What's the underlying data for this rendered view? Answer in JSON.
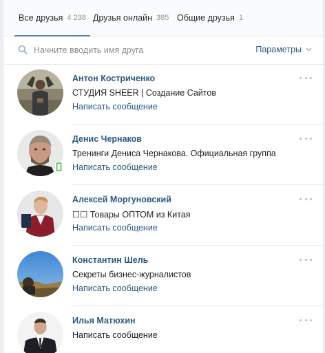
{
  "tabs": [
    {
      "label": "Все друзья",
      "count": "4 238"
    },
    {
      "label": "Друзья онлайн",
      "count": "385"
    },
    {
      "label": "Общие друзья",
      "count": "1"
    }
  ],
  "search": {
    "placeholder": "Начните вводить имя друга",
    "params_label": "Параметры"
  },
  "friends": [
    {
      "name": "Антон Костриченко",
      "subtitle": "СТУДИЯ SHEER | Создание Сайтов",
      "message_link": "Написать сообщение"
    },
    {
      "name": "Денис Чернаков",
      "subtitle": "Тренинги Дениса Чернакова. Официальная группа",
      "message_link": "Написать сообщение"
    },
    {
      "name": "Алексей Моргуновский",
      "subtitle": "☐☐ Товары ОПТОМ из Китая",
      "message_link": "Написать сообщение"
    },
    {
      "name": "Константин Шель",
      "subtitle": "Секреты бизнес-журналистов",
      "message_link": "Написать сообщение"
    },
    {
      "name": "Илья Матюхин",
      "subtitle": "",
      "message_link": "Написать сообщение"
    }
  ],
  "colors": {
    "accent": "#5181b8",
    "link": "#2a5885",
    "mobile_online": "#4bb34b"
  },
  "icons": [
    "search-icon",
    "chevron-down-icon",
    "more-icon",
    "mobile-online-icon"
  ]
}
